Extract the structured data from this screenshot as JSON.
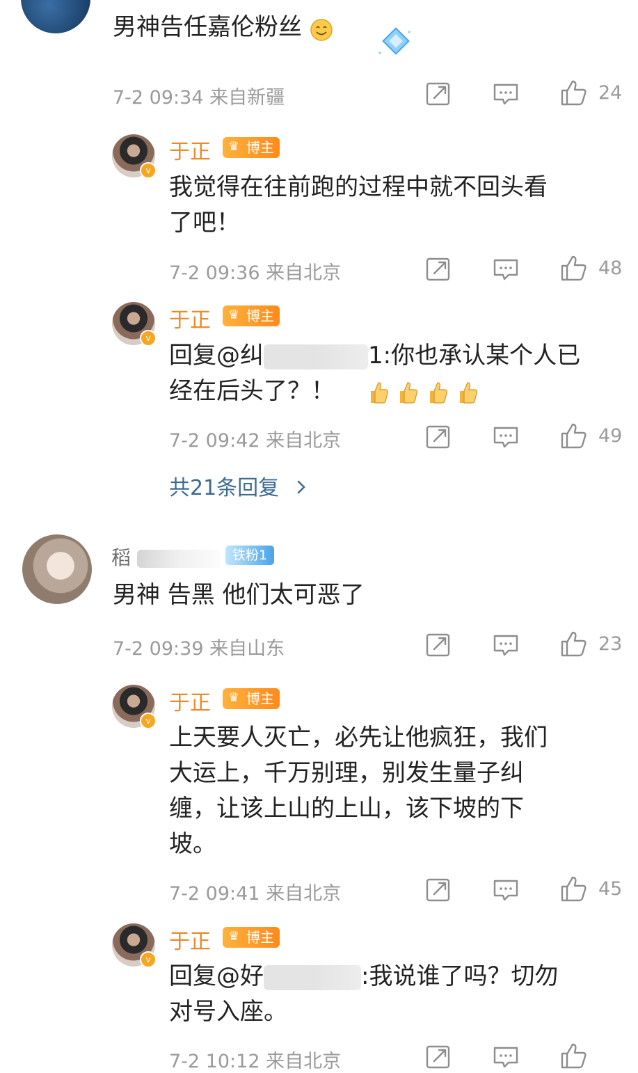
{
  "comments": [
    {
      "text": "男神告任嘉伦粉丝",
      "meta": "7-2 09:34 来自新疆",
      "likes": "24",
      "replies": [
        {
          "author": "于正",
          "badge": "博主",
          "text_line1": "我觉得在往前跑的过程中就不回头看",
          "text_line2": "了吧！",
          "meta": "7-2 09:36 来自北京",
          "likes": "48"
        },
        {
          "author": "于正",
          "badge": "博主",
          "text_line1_prefix": "回复@纠",
          "text_line1_suffix": "1:你也承认某个人已",
          "text_line2": "经在后头了？！",
          "meta": "7-2 09:42 来自北京",
          "likes": "49"
        }
      ],
      "more_replies": "共21条回复"
    },
    {
      "username": "稻",
      "fan_badge": "铁粉1",
      "text": "男神 告黑 他们太可恶了",
      "meta": "7-2 09:39 来自山东",
      "likes": "23",
      "replies": [
        {
          "author": "于正",
          "badge": "博主",
          "lines": [
            "上天要人灭亡，必先让他疯狂，我们",
            "大运上，千万别理，别发生量子纠",
            "缠，让该上山的上山，该下坡的下",
            "坡。"
          ],
          "meta": "7-2 09:41 来自北京",
          "likes": "45"
        },
        {
          "author": "于正",
          "badge": "博主",
          "text_line1_prefix": "回复@好",
          "text_line1_suffix": ":我说谁了吗？切勿",
          "text_line2": "对号入座。",
          "meta": "7-2 10:12 来自北京"
        }
      ]
    }
  ],
  "icons": {
    "share": "share-icon",
    "comment": "comment-icon",
    "like": "thumbs-up-icon",
    "smile": "smile-emoji-icon",
    "thumb_emoji": "thumbs-up-emoji-icon",
    "diamond": "diamond-icon",
    "chevron": "chevron-right-icon",
    "verified": "verified-v-icon",
    "crown": "crown-icon"
  },
  "colors": {
    "author": "#e98b2a",
    "meta": "#9a9a9a",
    "more_link": "#3d6b91",
    "badge_orange": "#ff9f2a",
    "fan_badge_blue": "#4aa3e9"
  }
}
